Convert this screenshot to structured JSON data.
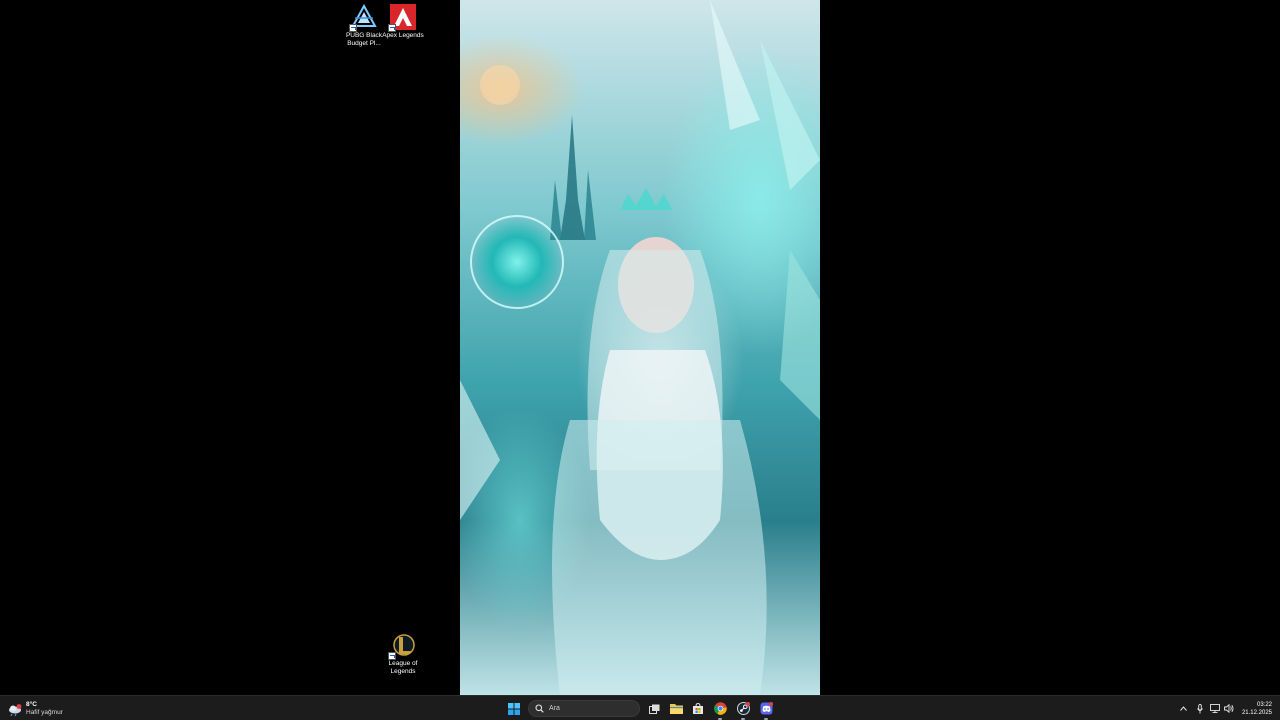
{
  "desktop": {
    "icons": [
      {
        "label": "PUBG Black Budget Pl...",
        "icon": "pubg-black-budget-icon"
      },
      {
        "label": "Apex Legends",
        "icon": "apex-legends-icon"
      },
      {
        "label": "League of Legends",
        "icon": "league-of-legends-icon"
      }
    ]
  },
  "taskbar": {
    "weather": {
      "temp": "8°C",
      "condition": "Hafif yağmur",
      "icon": "rain-cloud-icon"
    },
    "start_icon": "windows-start-icon",
    "search": {
      "placeholder": "Ara",
      "icon": "search-icon"
    },
    "apps": [
      {
        "icon": "task-view-icon"
      },
      {
        "icon": "file-explorer-icon"
      },
      {
        "icon": "microsoft-store-icon"
      },
      {
        "icon": "chrome-icon"
      },
      {
        "icon": "steam-icon"
      },
      {
        "icon": "discord-icon"
      }
    ],
    "tray": {
      "icons": [
        "chevron-up-icon",
        "microphone-icon",
        "network-icon",
        "volume-icon"
      ],
      "time": "03:22",
      "date": "21.12.2025"
    }
  },
  "colors": {
    "taskbar_bg": "#1c1c1c",
    "apex_red": "#d9262b",
    "league_gold": "#c8a040",
    "accent_blue": "#0078d4",
    "discord_blurple": "#5865f2"
  }
}
